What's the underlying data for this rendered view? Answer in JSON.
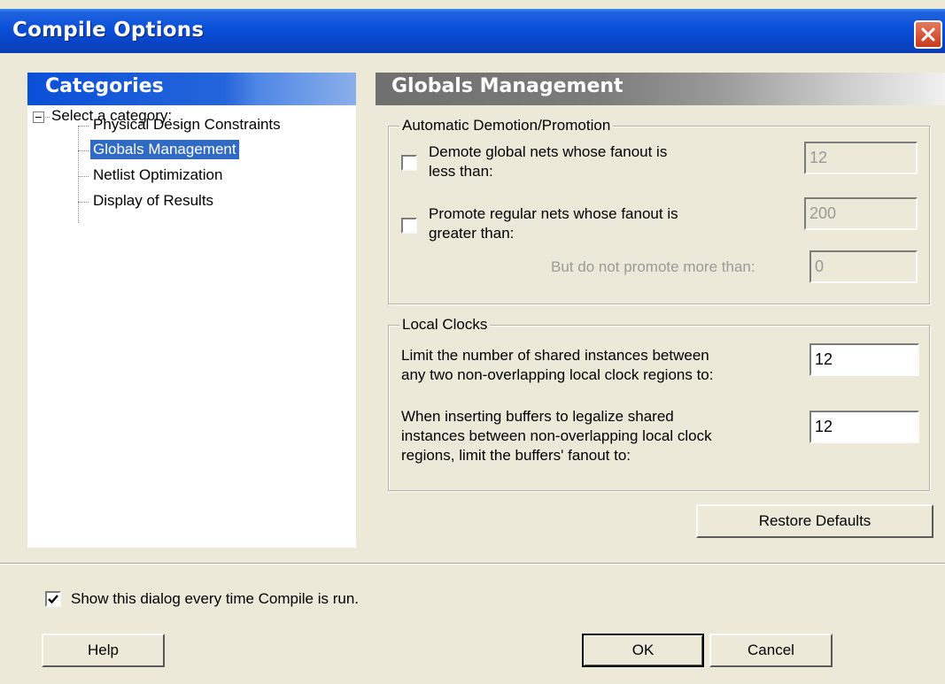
{
  "window": {
    "title": "Compile Options"
  },
  "categories": {
    "header": "Categories",
    "root": "Select a category:",
    "items": [
      {
        "label": "Physical Design Constraints",
        "selected": false
      },
      {
        "label": "Globals Management",
        "selected": true
      },
      {
        "label": "Netlist Optimization",
        "selected": false
      },
      {
        "label": "Display of Results",
        "selected": false
      }
    ]
  },
  "panel": {
    "title": "Globals Management"
  },
  "demotion": {
    "group_title": "Automatic Demotion/Promotion",
    "demote_label_1": "Demote global nets whose fanout is",
    "demote_label_2": "less than:",
    "demote_value": "12",
    "demote_checked": false,
    "promote_label_1": "Promote regular nets whose fanout is",
    "promote_label_2": "greater than:",
    "promote_value": "200",
    "promote_checked": false,
    "max_label": "But do not promote more than:",
    "max_value": "0"
  },
  "local_clocks": {
    "group_title": "Local Clocks",
    "limit_label_1": "Limit the number of shared instances between",
    "limit_label_2": "any two non-overlapping local clock regions to:",
    "limit_value": "12",
    "buffer_label_1": "When inserting buffers to legalize shared",
    "buffer_label_2": "instances between non-overlapping local clock",
    "buffer_label_3": "regions, limit the buffers' fanout to:",
    "buffer_value": "12"
  },
  "buttons": {
    "restore": "Restore Defaults",
    "help": "Help",
    "ok": "OK",
    "cancel": "Cancel"
  },
  "footer": {
    "show_dialog_label": "Show this dialog every time Compile is run.",
    "show_dialog_checked": true
  },
  "icons": {
    "close": "close-icon",
    "check": "checkmark-icon"
  }
}
